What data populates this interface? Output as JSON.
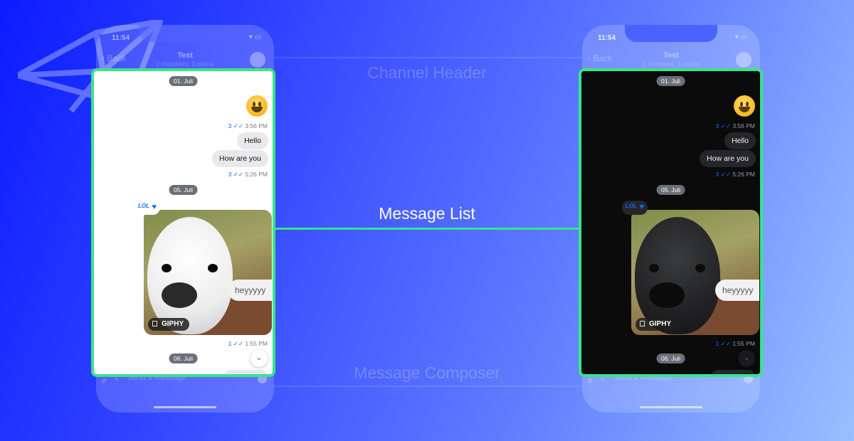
{
  "phone": {
    "status_time": "11:54",
    "status_icons": "▾ ▭",
    "header": {
      "back_label": "Back",
      "title": "Test",
      "subtitle": "2 members, 1 online"
    },
    "composer": {
      "placeholder": "Send a message",
      "attach_icon": "paperclip-icon",
      "command_icon": "lightning-icon",
      "send_icon": "send-icon"
    }
  },
  "labels": {
    "channel_header": "Channel Header",
    "message_list": "Message List",
    "message_composer": "Message Composer"
  },
  "messages": {
    "date_1": "01. Juli",
    "emoji_meta_count": "3",
    "emoji_meta_checks": "✓✓",
    "emoji_meta_time": "3:56 PM",
    "hello": "Hello",
    "how_are_you": "How are you",
    "how_meta_count": "3",
    "how_meta_time": "5:26 PM",
    "date_2": "05. Juli",
    "reaction_lol": "LOL",
    "reaction_heart": "♥",
    "gif_caption": "heyyyyy",
    "gif_badge": "GIPHY",
    "gif_meta_count": "1",
    "gif_meta_time": "1:55 PM",
    "date_3": "06. Juli",
    "scroll_arrow": "⌄"
  },
  "colors": {
    "accent_green": "#37e58a",
    "read_blue": "#0d6cff"
  }
}
